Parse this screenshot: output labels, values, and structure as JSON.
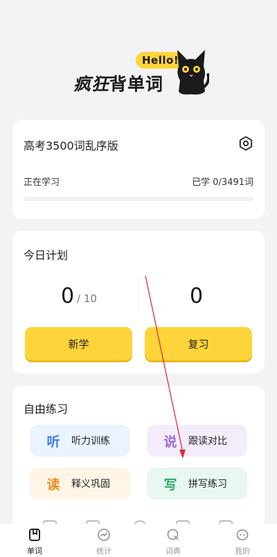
{
  "logo": {
    "bubble": "Hello!",
    "title_italic": "疯狂",
    "title_rest": "背单词"
  },
  "book": {
    "title": "高考3500词乱序版",
    "status": "正在学习",
    "learned": "已学 0/3491词",
    "progress": 0
  },
  "plan": {
    "title": "今日计划",
    "new_count": "0",
    "new_total": "/ 10",
    "review_count": "0",
    "new_button": "新学",
    "review_button": "复习"
  },
  "practice": {
    "title": "自由练习",
    "tiles": [
      {
        "glyph": "听",
        "label": "听力训练",
        "color": "#3f7ee8"
      },
      {
        "glyph": "说",
        "label": "跟读对比",
        "color": "#9b6ad8"
      },
      {
        "glyph": "读",
        "label": "释义巩固",
        "color": "#f08a1c"
      },
      {
        "glyph": "写",
        "label": "拼写练习",
        "color": "#2daa6a"
      }
    ]
  },
  "nav": {
    "items": [
      {
        "label": "单词",
        "icon": "book-icon",
        "active": true
      },
      {
        "label": "统计",
        "icon": "chart-icon",
        "active": false
      },
      {
        "label": "词典",
        "icon": "search-icon",
        "active": false
      },
      {
        "label": "我的",
        "icon": "face-icon",
        "active": false
      }
    ]
  },
  "colors": {
    "accent": "#ffd43b",
    "annotation_arrow": "#d9303a"
  }
}
